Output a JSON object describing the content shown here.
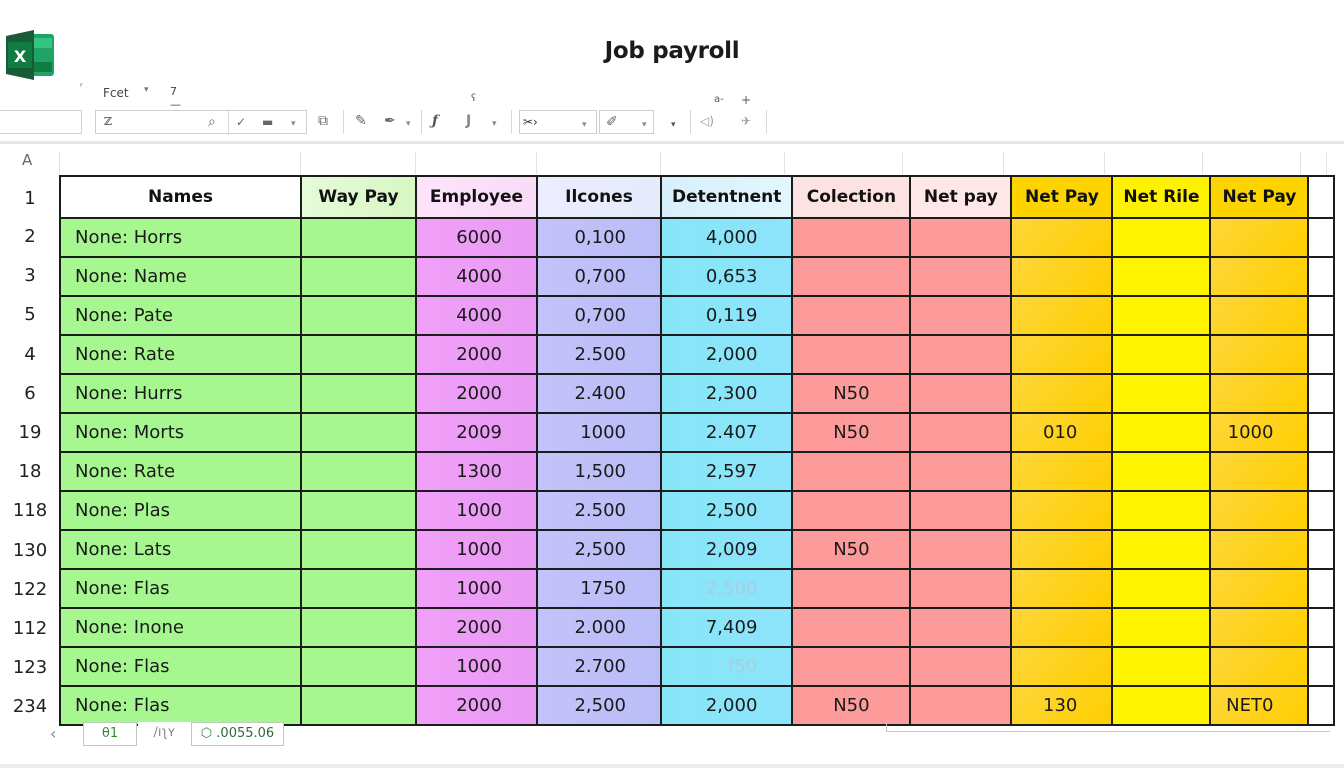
{
  "app": {
    "icon": "excel-logo-icon",
    "title": "Job payroll"
  },
  "menu": {
    "font_name": "Fcet",
    "font_caret": "▾",
    "font_size": "7 —",
    "tick_mark": "ʳ",
    "top_small_1": "ʕ",
    "top_small_2": "a-",
    "top_small_3": "+"
  },
  "toolbar": {
    "name_box_value": "",
    "formula_value": "ℤ",
    "icons": [
      "search-icon",
      "check-icon",
      "fill-icon",
      "paste-special-icon",
      "brush-icon",
      "pen-icon",
      "function-icon",
      "align-icon",
      "format-icon",
      "highlight-icon",
      "more-icon",
      "audio-icon",
      "pin-icon"
    ],
    "format_dropdown_value": "✂›"
  },
  "grid": {
    "column_letter": "A",
    "headers": [
      "Names",
      "Way Pay",
      "Employee",
      "Ilcones",
      "Detentnent",
      "Colection",
      "Net pay",
      "Net Pay",
      "Net Rile",
      "Net Pay",
      ""
    ],
    "header_row_number": "1",
    "rows": [
      {
        "row": "2",
        "name": "None: Horrs",
        "way_pay": "",
        "employee": "6000",
        "incomes": "0,100",
        "deduction": "4,000",
        "collection": "",
        "net_pay": "",
        "net_pay_2": "",
        "net_rile": "",
        "net_pay_3": ""
      },
      {
        "row": "3",
        "name": "None: Name",
        "way_pay": "",
        "employee": "4000",
        "incomes": "0,700",
        "deduction": "0,653",
        "collection": "",
        "net_pay": "",
        "net_pay_2": "",
        "net_rile": "",
        "net_pay_3": ""
      },
      {
        "row": "5",
        "name": "None: Pate",
        "way_pay": "",
        "employee": "4000",
        "incomes": "0,700",
        "deduction": "0,119",
        "collection": "",
        "net_pay": "",
        "net_pay_2": "",
        "net_rile": "",
        "net_pay_3": ""
      },
      {
        "row": "4",
        "name": "None: Rate",
        "way_pay": "",
        "employee": "2000",
        "incomes": "2.500",
        "deduction": "2,000",
        "collection": "",
        "net_pay": "",
        "net_pay_2": "",
        "net_rile": "",
        "net_pay_3": ""
      },
      {
        "row": "6",
        "name": "None: Hurrs",
        "way_pay": "",
        "employee": "2000",
        "incomes": "2.400",
        "deduction": "2,300",
        "collection": "N50",
        "net_pay": "",
        "net_pay_2": "",
        "net_rile": "",
        "net_pay_3": ""
      },
      {
        "row": "19",
        "name": "None: Morts",
        "way_pay": "",
        "employee": "2009",
        "incomes": "1000",
        "deduction": "2.407",
        "collection": "N50",
        "net_pay": "",
        "net_pay_2": "010",
        "net_rile": "",
        "net_pay_3": "1000"
      },
      {
        "row": "18",
        "name": "None: Rate",
        "way_pay": "",
        "employee": "1300",
        "incomes": "1,500",
        "deduction": "2,597",
        "collection": "",
        "net_pay": "",
        "net_pay_2": "",
        "net_rile": "",
        "net_pay_3": ""
      },
      {
        "row": "118",
        "name": "None: Plas",
        "way_pay": "",
        "employee": "1000",
        "incomes": "2.500",
        "deduction": "2,500",
        "collection": "",
        "net_pay": "",
        "net_pay_2": "",
        "net_rile": "",
        "net_pay_3": ""
      },
      {
        "row": "130",
        "name": "None: Lats",
        "way_pay": "",
        "employee": "1000",
        "incomes": "2,500",
        "deduction": "2,009",
        "collection": "N50",
        "net_pay": "",
        "net_pay_2": "",
        "net_rile": "",
        "net_pay_3": ""
      },
      {
        "row": "122",
        "name": "None: Flas",
        "way_pay": "",
        "employee": "1000",
        "incomes": "1750",
        "deduction": "2,500",
        "deduction_faded": true,
        "collection": "",
        "net_pay": "",
        "net_pay_2": "",
        "net_rile": "",
        "net_pay_3": ""
      },
      {
        "row": "112",
        "name": "None: Inone",
        "way_pay": "",
        "employee": "2000",
        "incomes": "2.000",
        "deduction": "7,409",
        "collection": "",
        "net_pay": "",
        "net_pay_2": "",
        "net_rile": "",
        "net_pay_3": ""
      },
      {
        "row": "123",
        "name": "None: Flas",
        "way_pay": "",
        "employee": "1000",
        "incomes": "2.700",
        "deduction": "f50",
        "deduction_faded": true,
        "collection": "",
        "net_pay": "",
        "net_pay_2": "",
        "net_rile": "",
        "net_pay_3": ""
      },
      {
        "row": "234",
        "name": "None: Flas",
        "way_pay": "",
        "employee": "2000",
        "incomes": "2,500",
        "deduction": "2,000",
        "collection": "N50",
        "net_pay": "",
        "net_pay_2": "130",
        "net_rile": "",
        "net_pay_3": "NET0"
      }
    ]
  },
  "bottom": {
    "prev_label": "‹",
    "tabs": [
      {
        "label": "θ1",
        "active": true
      },
      {
        "label": "∕ıʅʏ",
        "active": false
      },
      {
        "label": ".0055.06",
        "icon": "sheet-status-icon",
        "active": false
      }
    ]
  },
  "colors": {
    "names_fill": "#a6f78f",
    "employee_fill": "#f1a0f8",
    "incomes_fill": "#c5c2fb",
    "deduction_fill": "#86e6f7",
    "collection_fill": "#fd9b9b",
    "gold_fill": "#ffd21f",
    "yellow_fill": "#fff400",
    "excel_green": "#1d6f42"
  }
}
